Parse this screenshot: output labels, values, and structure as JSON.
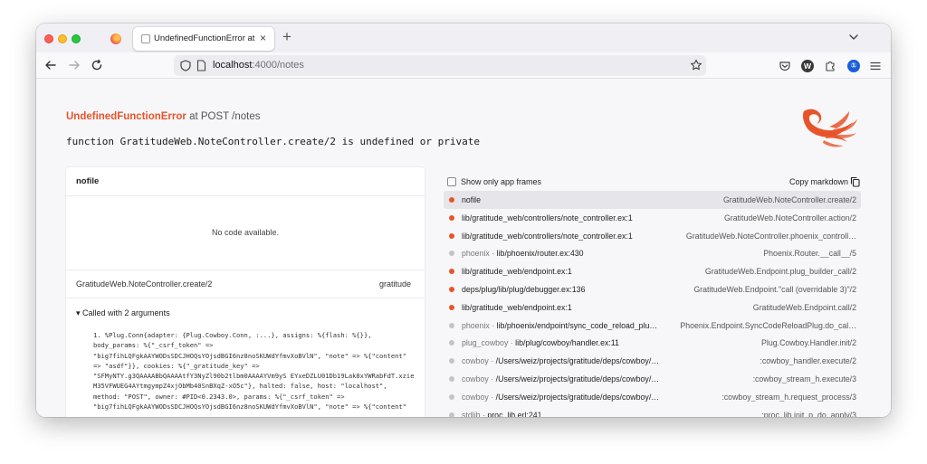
{
  "browser": {
    "tab_title": "UndefinedFunctionError at POST /notes",
    "tab_close": "×",
    "new_tab": "+",
    "url_host": "localhost",
    "url_path": ":4000/notes",
    "extension_w": "W",
    "onepassword_glyph": "①"
  },
  "error": {
    "name": "UndefinedFunctionError",
    "where": " at POST /notes",
    "message": "function GratitudeWeb.NoteController.create/2 is undefined or private"
  },
  "code_panel": {
    "file": "nofile",
    "no_code": "No code available.",
    "function": "GratitudeWeb.NoteController.create/2",
    "app": "gratitude",
    "called_with": "▾ Called with 2 arguments",
    "args_text": "1. %Plug.Conn{adapter: {Plug.Cowboy.Conn, :...}, assigns: %{flash: %{}},\nbody_params: %{\"_csrf_token\" =>\n\"big7fihLQFgkAAYWODsSDCJHOQsYOjsdBGI6nz8noSKUWdYfmvXoBVlN\", \"note\" => %{\"content\"\n=> \"asdf\"}}, cookies: %{\"_gratitude_key\" =>\n\"SFMyNTY.g3QAAAABbQAAAAtfY3NyZl90b2tlbm0AAAAYVm9yS EYxeDZLU01Db19Lak8xYWRabFdT.xzie\nM35VFWUEG4AYtmgympZ4xjObMb40SnBXqZ-xO5c\"}, halted: false, host: \"localhost\",\nmethod: \"POST\", owner: #PID<0.2343.0>, params: %{\"_csrf_token\" =>\n\"big7fihLQFgkAAYWODsSDCJHOQsYOjsdBGI6nz8noSKUWdYfmvXoBVlN\", \"note\" => %{\"content\""
  },
  "frames_header": {
    "show_only_app": "Show only app frames",
    "copy_markdown": "Copy markdown"
  },
  "colors": {
    "app_dot": "#e8542a",
    "lib_dot": "#c4c4c8",
    "phoenix_orange": "#e8542a"
  },
  "frames": [
    {
      "app": "",
      "file": "nofile",
      "fn": "GratitudeWeb.NoteController.create/2",
      "kind": "app",
      "active": true
    },
    {
      "app": "",
      "file": "lib/gratitude_web/controllers/note_controller.ex:1",
      "fn": "GratitudeWeb.NoteController.action/2",
      "kind": "app",
      "active": false
    },
    {
      "app": "",
      "file": "lib/gratitude_web/controllers/note_controller.ex:1",
      "fn": "GratitudeWeb.NoteController.phoenix_controll…",
      "kind": "app",
      "active": false
    },
    {
      "app": "phoenix · ",
      "file": "lib/phoenix/router.ex:430",
      "fn": "Phoenix.Router.__call__/5",
      "kind": "lib",
      "active": false
    },
    {
      "app": "",
      "file": "lib/gratitude_web/endpoint.ex:1",
      "fn": "GratitudeWeb.Endpoint.plug_builder_call/2",
      "kind": "app",
      "active": false
    },
    {
      "app": "",
      "file": "deps/plug/lib/plug/debugger.ex:136",
      "fn": "GratitudeWeb.Endpoint.\"call (overridable 3)\"/2",
      "kind": "app",
      "active": false
    },
    {
      "app": "",
      "file": "lib/gratitude_web/endpoint.ex:1",
      "fn": "GratitudeWeb.Endpoint.call/2",
      "kind": "app",
      "active": false
    },
    {
      "app": "phoenix · ",
      "file": "lib/phoenix/endpoint/sync_code_reload_plu…",
      "fn": "Phoenix.Endpoint.SyncCodeReloadPlug.do_cal…",
      "kind": "lib",
      "active": false
    },
    {
      "app": "plug_cowboy · ",
      "file": "lib/plug/cowboy/handler.ex:11",
      "fn": "Plug.Cowboy.Handler.init/2",
      "kind": "lib",
      "active": false
    },
    {
      "app": "cowboy · ",
      "file": "/Users/weiz/projects/gratitude/deps/cowboy/…",
      "fn": ":cowboy_handler.execute/2",
      "kind": "lib",
      "active": false
    },
    {
      "app": "cowboy · ",
      "file": "/Users/weiz/projects/gratitude/deps/cowboy/…",
      "fn": ":cowboy_stream_h.execute/3",
      "kind": "lib",
      "active": false
    },
    {
      "app": "cowboy · ",
      "file": "/Users/weiz/projects/gratitude/deps/cowboy/…",
      "fn": ":cowboy_stream_h.request_process/3",
      "kind": "lib",
      "active": false
    },
    {
      "app": "stdlib · ",
      "file": "proc_lib.erl:241",
      "fn": ":proc_lib.init_p_do_apply/3",
      "kind": "lib",
      "active": false
    }
  ]
}
